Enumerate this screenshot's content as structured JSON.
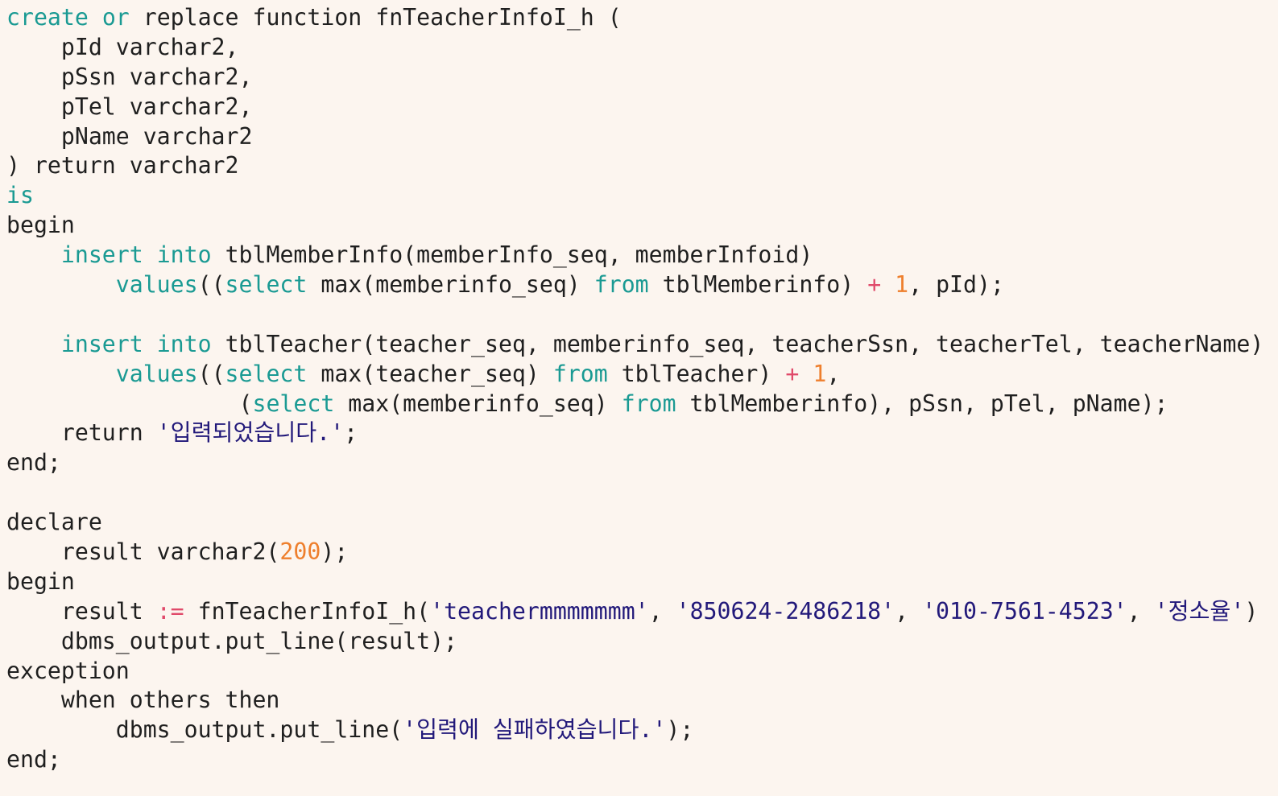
{
  "editor": {
    "background": "#fcf5ef",
    "colors": {
      "plain": "#1f1f1f",
      "keyword": "#1a9a93",
      "operator": "#e04a6a",
      "number": "#ee7f2d",
      "string": "#22197a"
    },
    "lines": [
      [
        [
          "kw",
          "create"
        ],
        [
          "pl",
          " "
        ],
        [
          "kw",
          "or"
        ],
        [
          "pl",
          " replace function fnTeacherInfoI_h ("
        ]
      ],
      [
        [
          "pl",
          "    pId varchar2,"
        ]
      ],
      [
        [
          "pl",
          "    pSsn varchar2,"
        ]
      ],
      [
        [
          "pl",
          "    pTel varchar2,"
        ]
      ],
      [
        [
          "pl",
          "    pName varchar2"
        ]
      ],
      [
        [
          "pl",
          ") return varchar2"
        ]
      ],
      [
        [
          "kw",
          "is"
        ]
      ],
      [
        [
          "pl",
          "begin"
        ]
      ],
      [
        [
          "pl",
          "    "
        ],
        [
          "kw",
          "insert"
        ],
        [
          "pl",
          " "
        ],
        [
          "kw",
          "into"
        ],
        [
          "pl",
          " tblMemberInfo(memberInfo_seq, memberInfoid)"
        ]
      ],
      [
        [
          "pl",
          "        "
        ],
        [
          "kw",
          "values"
        ],
        [
          "pl",
          "(("
        ],
        [
          "kw",
          "select"
        ],
        [
          "pl",
          " max(memberinfo_seq) "
        ],
        [
          "kw",
          "from"
        ],
        [
          "pl",
          " tblMemberinfo) "
        ],
        [
          "op",
          "+"
        ],
        [
          "pl",
          " "
        ],
        [
          "num",
          "1"
        ],
        [
          "pl",
          ", pId);"
        ]
      ],
      [],
      [
        [
          "pl",
          "    "
        ],
        [
          "kw",
          "insert"
        ],
        [
          "pl",
          " "
        ],
        [
          "kw",
          "into"
        ],
        [
          "pl",
          " tblTeacher(teacher_seq, memberinfo_seq, teacherSsn, teacherTel, teacherName)"
        ]
      ],
      [
        [
          "pl",
          "        "
        ],
        [
          "kw",
          "values"
        ],
        [
          "pl",
          "(("
        ],
        [
          "kw",
          "select"
        ],
        [
          "pl",
          " max(teacher_seq) "
        ],
        [
          "kw",
          "from"
        ],
        [
          "pl",
          " tblTeacher) "
        ],
        [
          "op",
          "+"
        ],
        [
          "pl",
          " "
        ],
        [
          "num",
          "1"
        ],
        [
          "pl",
          ","
        ]
      ],
      [
        [
          "pl",
          "                 ("
        ],
        [
          "kw",
          "select"
        ],
        [
          "pl",
          " max(memberinfo_seq) "
        ],
        [
          "kw",
          "from"
        ],
        [
          "pl",
          " tblMemberinfo), pSsn, pTel, pName);"
        ]
      ],
      [
        [
          "pl",
          "    return "
        ],
        [
          "str",
          "'입력되었습니다.'"
        ],
        [
          "pl",
          ";"
        ]
      ],
      [
        [
          "pl",
          "end;"
        ]
      ],
      [],
      [
        [
          "pl",
          "declare"
        ]
      ],
      [
        [
          "pl",
          "    result varchar2("
        ],
        [
          "num",
          "200"
        ],
        [
          "pl",
          ");"
        ]
      ],
      [
        [
          "pl",
          "begin"
        ]
      ],
      [
        [
          "pl",
          "    result "
        ],
        [
          "op",
          ":="
        ],
        [
          "pl",
          " fnTeacherInfoI_h("
        ],
        [
          "str",
          "'teachermmmmmmm'"
        ],
        [
          "pl",
          ", "
        ],
        [
          "str",
          "'850624-2486218'"
        ],
        [
          "pl",
          ", "
        ],
        [
          "str",
          "'010-7561-4523'"
        ],
        [
          "pl",
          ", "
        ],
        [
          "str",
          "'정소율'"
        ],
        [
          "pl",
          ")"
        ]
      ],
      [
        [
          "pl",
          "    dbms_output.put_line(result);"
        ]
      ],
      [
        [
          "pl",
          "exception"
        ]
      ],
      [
        [
          "pl",
          "    when others then"
        ]
      ],
      [
        [
          "pl",
          "        dbms_output.put_line("
        ],
        [
          "str",
          "'입력에 실패하였습니다.'"
        ],
        [
          "pl",
          ");"
        ]
      ],
      [
        [
          "pl",
          "end;"
        ]
      ]
    ]
  }
}
